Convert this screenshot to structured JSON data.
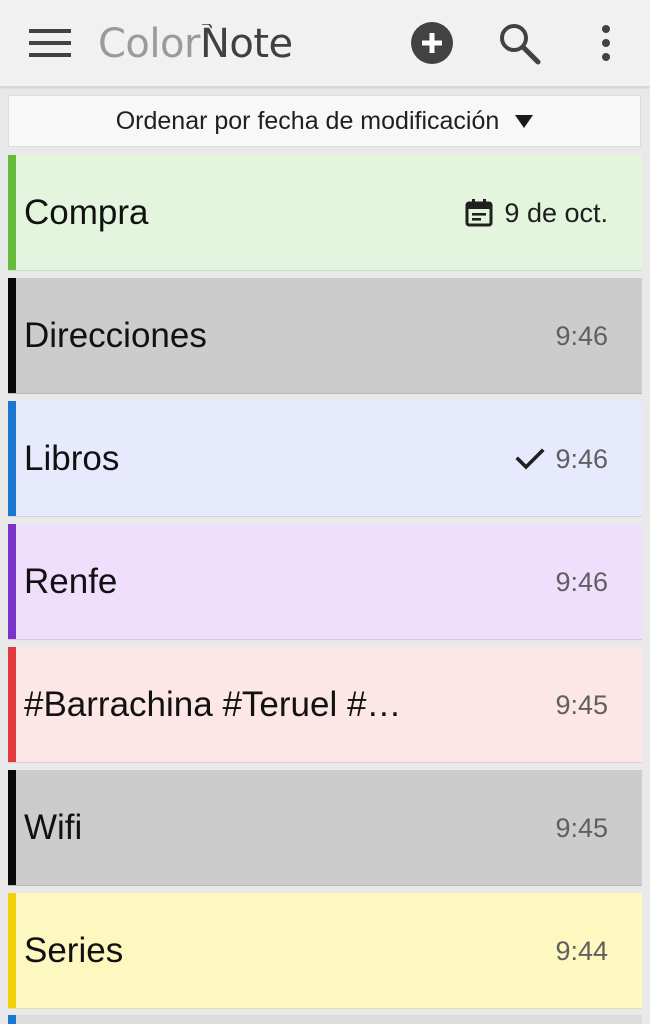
{
  "app": {
    "logo_color": "Color",
    "logo_note": "Note"
  },
  "toolbar": {
    "menu_icon": "hamburger-menu-icon",
    "add_icon": "add-circle-icon",
    "search_icon": "search-icon",
    "more_icon": "more-vertical-icon"
  },
  "sort": {
    "label": "Ordenar por fecha de modificación",
    "arrow_icon": "dropdown-arrow-icon"
  },
  "notes": [
    {
      "title": "Compra",
      "time": "9 de oct.",
      "icon": "calendar-icon",
      "bg": "#e3f6dd",
      "stripe": "#66bb3a",
      "time_dark": true
    },
    {
      "title": "Direcciones",
      "time": "9:46",
      "icon": "",
      "bg": "#cccccc",
      "stripe": "#0a0a0a",
      "time_dark": false
    },
    {
      "title": "Libros",
      "time": "9:46",
      "icon": "checkmark-icon",
      "bg": "#e7e9fc",
      "stripe": "#1b76d2",
      "time_dark": false
    },
    {
      "title": "Renfe",
      "time": "9:46",
      "icon": "",
      "bg": "#efdffd",
      "stripe": "#7a33c9",
      "time_dark": false
    },
    {
      "title": "#Barrachina #Teruel #…",
      "time": "9:45",
      "icon": "",
      "bg": "#fde6e6",
      "stripe": "#e0393e",
      "time_dark": false
    },
    {
      "title": "Wifi",
      "time": "9:45",
      "icon": "",
      "bg": "#cccccc",
      "stripe": "#0a0a0a",
      "time_dark": false
    },
    {
      "title": "Series",
      "time": "9:44",
      "icon": "",
      "bg": "#fdf7c0",
      "stripe": "#f2d20c",
      "time_dark": false
    }
  ],
  "colors": {
    "toolbar_bg": "#f1f1f1",
    "page_bg": "#e9e9e9",
    "next_stripe": "#1b76d2"
  }
}
